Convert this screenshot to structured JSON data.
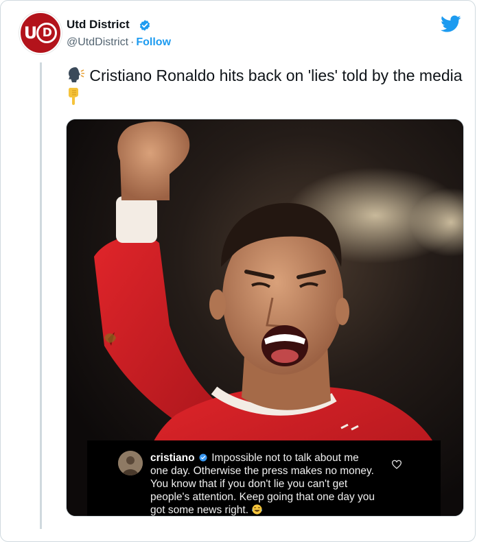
{
  "account": {
    "name": "Utd District",
    "handle": "@UtdDistrict",
    "separator": "·",
    "follow_label": "Follow",
    "avatar_text": "D",
    "verified_icon": "verified-badge-icon",
    "brand_color": "#1d9bf0"
  },
  "tweet": {
    "text": "Cristiano Ronaldo hits back on 'lies' told by the media",
    "lead_emoji": "speaking-head-icon",
    "trail_emoji": "pointing-down-icon"
  },
  "media": {
    "caption_user": "cristiano",
    "caption_text": "Impossible not to talk about me one day. Otherwise the press makes no money. You know that if you don't lie you can't get people's attention. Keep going that one day you got some news right.",
    "caption_emoji": "laughing-tears-icon",
    "heart_icon": "heart-icon"
  }
}
